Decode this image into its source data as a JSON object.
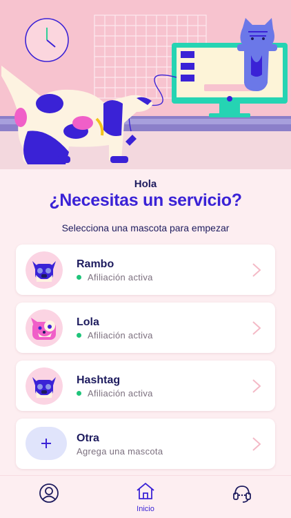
{
  "header": {
    "greeting": "Hola",
    "headline": "¿Necesitas un servicio?",
    "subtitle": "Selecciona una mascota para empezar"
  },
  "pets": [
    {
      "name": "Rambo",
      "status": "Afiliación activa",
      "avatar_icon": "dog-face-icon"
    },
    {
      "name": "Lola",
      "status": "Afiliación activa",
      "avatar_icon": "cat-face-icon"
    },
    {
      "name": "Hashtag",
      "status": "Afiliación activa",
      "avatar_icon": "dog-face-icon"
    }
  ],
  "other": {
    "name": "Otra",
    "subtitle": "Agrega una mascota",
    "icon": "plus-icon"
  },
  "nav": {
    "items": [
      {
        "icon": "profile-icon",
        "label": ""
      },
      {
        "icon": "home-icon",
        "label": "Inicio"
      },
      {
        "icon": "support-headset-icon",
        "label": ""
      }
    ]
  },
  "colors": {
    "accent": "#3a22d6",
    "dark_text": "#1d1b5e",
    "status_active": "#1fc47a",
    "background": "#fdeef1",
    "chevron": "#f4b9c6"
  }
}
